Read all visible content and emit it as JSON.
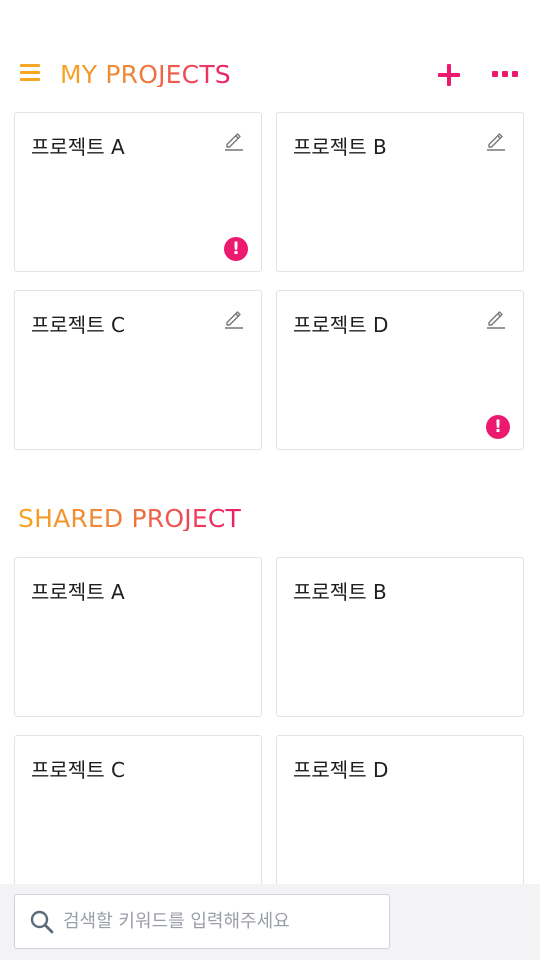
{
  "header": {
    "title": "MY PROJECTS",
    "menu_icon": "hamburger-menu-icon",
    "add_icon": "plus-icon",
    "more_icon": "more-dots-icon"
  },
  "my_projects": [
    {
      "name": "프로젝트 A",
      "editable": true,
      "alert": true
    },
    {
      "name": "프로젝트 B",
      "editable": true,
      "alert": false
    },
    {
      "name": "프로젝트 C",
      "editable": true,
      "alert": false
    },
    {
      "name": "프로젝트 D",
      "editable": true,
      "alert": true
    }
  ],
  "shared": {
    "title": "SHARED PROJECT",
    "projects": [
      {
        "name": "프로젝트 A"
      },
      {
        "name": "프로젝트 B"
      },
      {
        "name": "프로젝트 C"
      },
      {
        "name": "프로젝트 D"
      }
    ]
  },
  "search": {
    "placeholder": "검색할 키워드를 입력해주세요",
    "value": ""
  },
  "alert_glyph": "!",
  "colors": {
    "accent_orange": "#f5a623",
    "accent_pink": "#ec1a6e",
    "card_border": "#e3e3e3",
    "bottom_bar_bg": "#f3f3f6"
  }
}
